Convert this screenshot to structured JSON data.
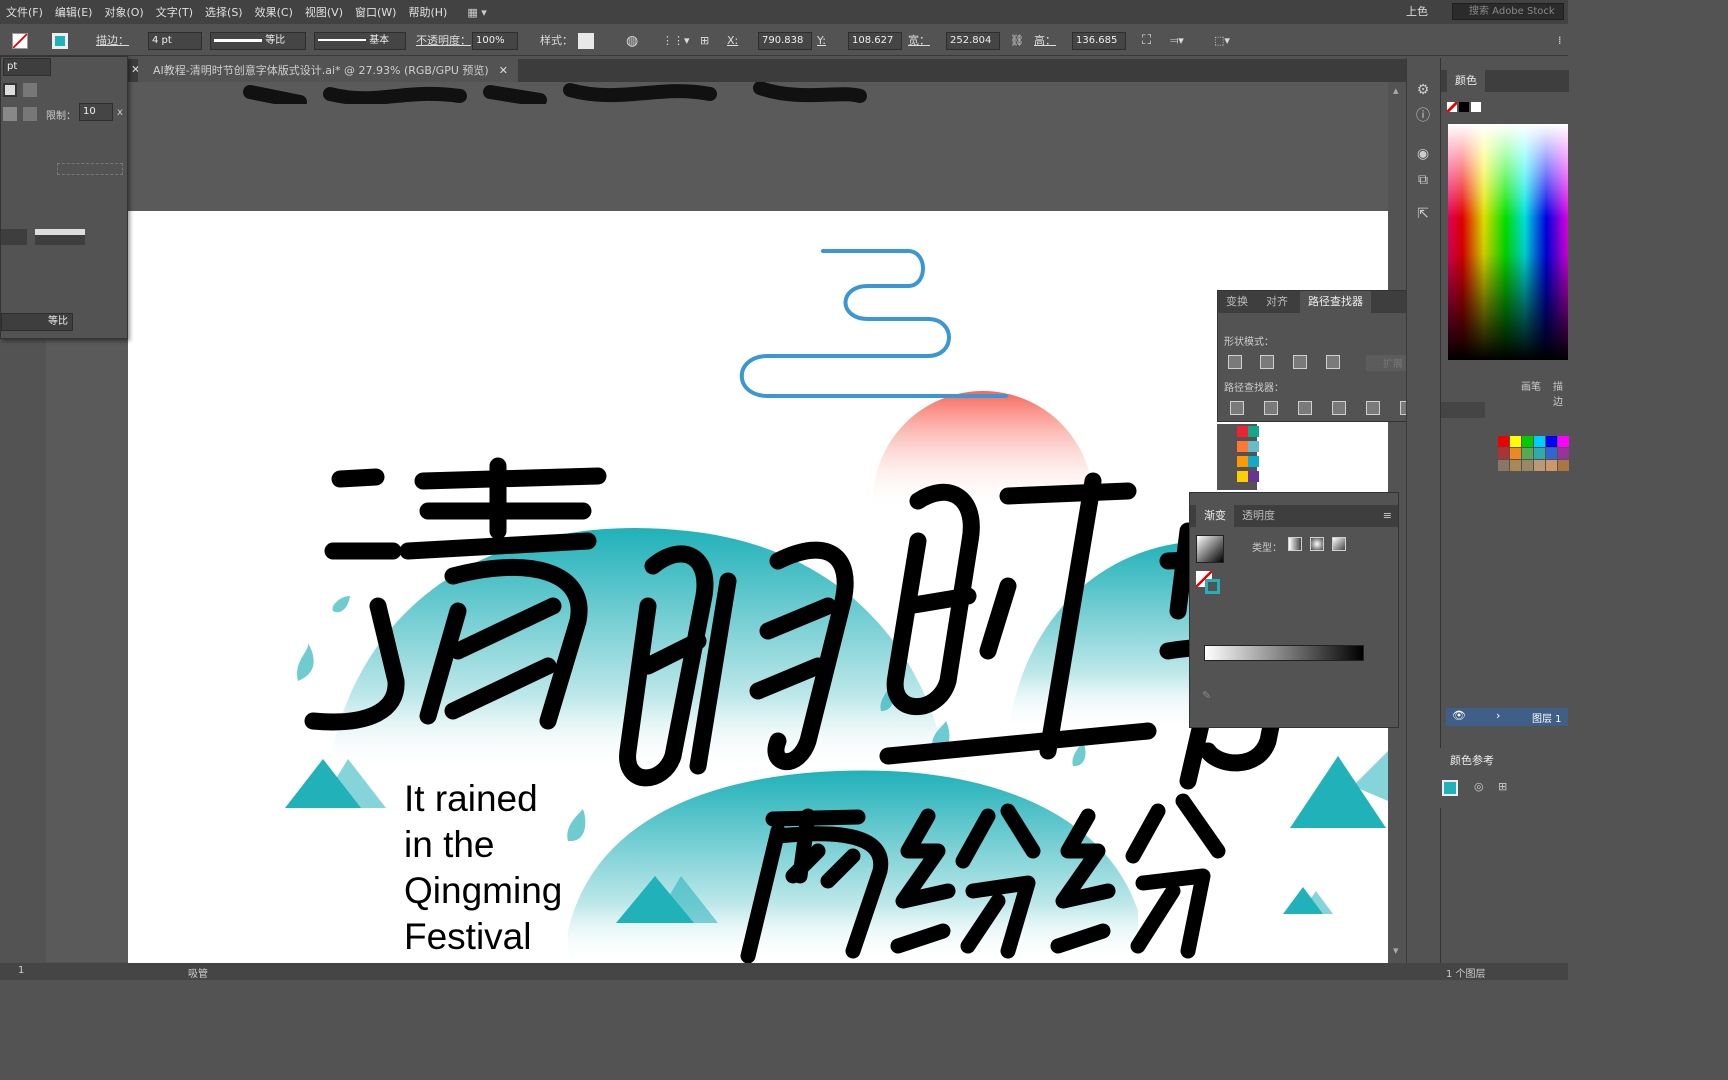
{
  "menu": [
    "文件(F)",
    "编辑(E)",
    "对象(O)",
    "文字(T)",
    "选择(S)",
    "效果(C)",
    "视图(V)",
    "窗口(W)",
    "帮助(H)"
  ],
  "workspace": "上色",
  "stock_placeholder": "搜索 Adobe Stock",
  "control": {
    "stroke_label": "描边：",
    "stroke_value": "4 pt",
    "profile": "等比",
    "brush": "基本",
    "opacity_label": "不透明度：",
    "opacity": "100%",
    "style_label": "样式：",
    "x_label": "X:",
    "x": "790.838",
    "y_label": "Y:",
    "y": "108.627",
    "w_label": "宽：",
    "w": "252.804",
    "h_label": "高：",
    "h": "136.685"
  },
  "doc_tab": "AI教程-清明时节创意字体版式设计.ai* @ 27.93% (RGB/GPU 预览)",
  "stroke_panel": {
    "unit": "pt",
    "limit_label": "限制：",
    "limit": "10",
    "profile": "等比"
  },
  "artwork": {
    "english": "It rained\nin the\nQingming\nFestival",
    "title_chars": [
      "清",
      "明",
      "时",
      "节"
    ],
    "sub_chars": [
      "雨",
      "纷",
      "纷"
    ]
  },
  "colors": {
    "teal": "#20b1b9",
    "cloud_blue": "#3a97d4",
    "sun": "#f7665a"
  },
  "pathfinder": {
    "tabs": [
      "变换",
      "对齐",
      "路径查找器"
    ],
    "shape_modes": "形状模式：",
    "pathfinders": "路径查找器：",
    "expand": "扩展"
  },
  "gradient": {
    "tabs": [
      "渐变",
      "透明度"
    ],
    "type_label": "类型："
  },
  "color_panel": {
    "title": "颜色"
  },
  "layers": {
    "layer": "图层 1",
    "count": "1 个图层"
  },
  "color_guide": {
    "title": "颜色参考"
  },
  "right_tabs": [
    "画笔",
    "描边"
  ],
  "status": {
    "zoom": "1",
    "tool": "吸管"
  }
}
